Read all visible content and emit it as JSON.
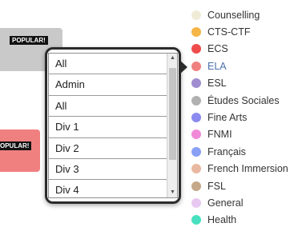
{
  "cards": {
    "badge_1": "POPULAR!",
    "badge_2": "OPULAR!",
    "card_1_color": "#c9c9c9",
    "card_2_color": "#f08080"
  },
  "dropdown": {
    "options": [
      "All",
      "Admin",
      "All",
      "Div 1",
      "Div 2",
      "Div 3",
      "Div 4"
    ],
    "scroll_up": "▲",
    "scroll_down": "▼"
  },
  "legend": {
    "items": [
      {
        "label": "Counselling",
        "color": "#f0ebd8"
      },
      {
        "label": "CTS-CTF",
        "color": "#f5b547"
      },
      {
        "label": "ECS",
        "color": "#ef4b4b"
      },
      {
        "label": "ELA",
        "color": "#f08080"
      },
      {
        "label": "ESL",
        "color": "#a08cd0"
      },
      {
        "label": "Études Sociales",
        "color": "#b0b0b0"
      },
      {
        "label": "Fine Arts",
        "color": "#8a8af0"
      },
      {
        "label": "FNMI",
        "color": "#f08ad8"
      },
      {
        "label": "Français",
        "color": "#8aa0f5"
      },
      {
        "label": "French Immersion",
        "color": "#e8b8a0"
      },
      {
        "label": "FSL",
        "color": "#c4a888"
      },
      {
        "label": "General",
        "color": "#e8c8f0"
      },
      {
        "label": "Health",
        "color": "#48e0c0"
      }
    ]
  }
}
